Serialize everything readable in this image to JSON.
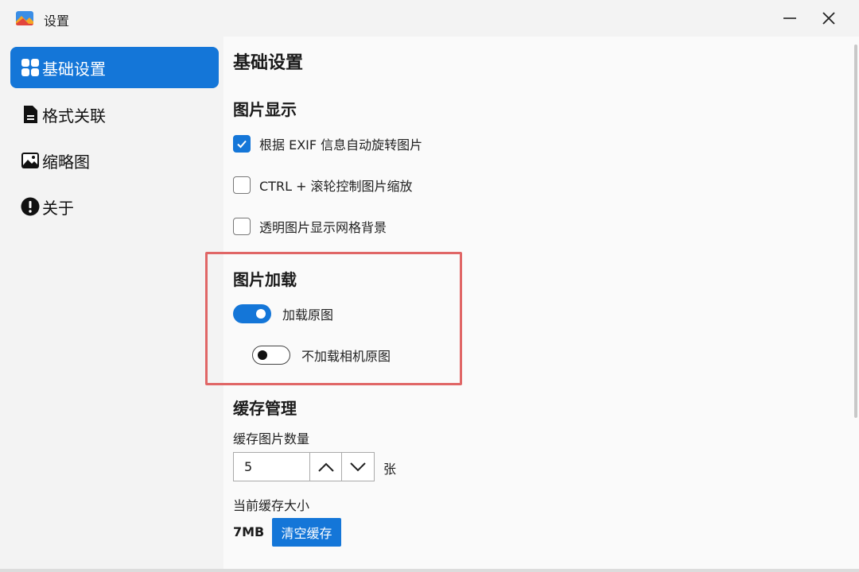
{
  "window": {
    "title": "设置"
  },
  "sidebar": {
    "items": [
      {
        "label": "基础设置",
        "icon": "grid-icon",
        "active": true
      },
      {
        "label": "格式关联",
        "icon": "document-icon",
        "active": false
      },
      {
        "label": "缩略图",
        "icon": "image-icon",
        "active": false
      },
      {
        "label": "关于",
        "icon": "info-icon",
        "active": false
      }
    ]
  },
  "main": {
    "title": "基础设置",
    "display": {
      "title": "图片显示",
      "options": [
        {
          "label": "根据 EXIF 信息自动旋转图片",
          "checked": true
        },
        {
          "label": "CTRL + 滚轮控制图片缩放",
          "checked": false
        },
        {
          "label": "透明图片显示网格背景",
          "checked": false
        }
      ]
    },
    "loading": {
      "title": "图片加载",
      "toggles": [
        {
          "label": "加载原图",
          "on": true
        },
        {
          "label": "不加载相机原图",
          "on": false
        }
      ]
    },
    "cache": {
      "title": "缓存管理",
      "count_label": "缓存图片数量",
      "count_value": "5",
      "count_unit": "张",
      "size_label": "当前缓存大小",
      "size_value": "7MB",
      "clear_button": "清空缓存"
    }
  },
  "colors": {
    "accent": "#1476d8",
    "highlight": "#e06666"
  }
}
